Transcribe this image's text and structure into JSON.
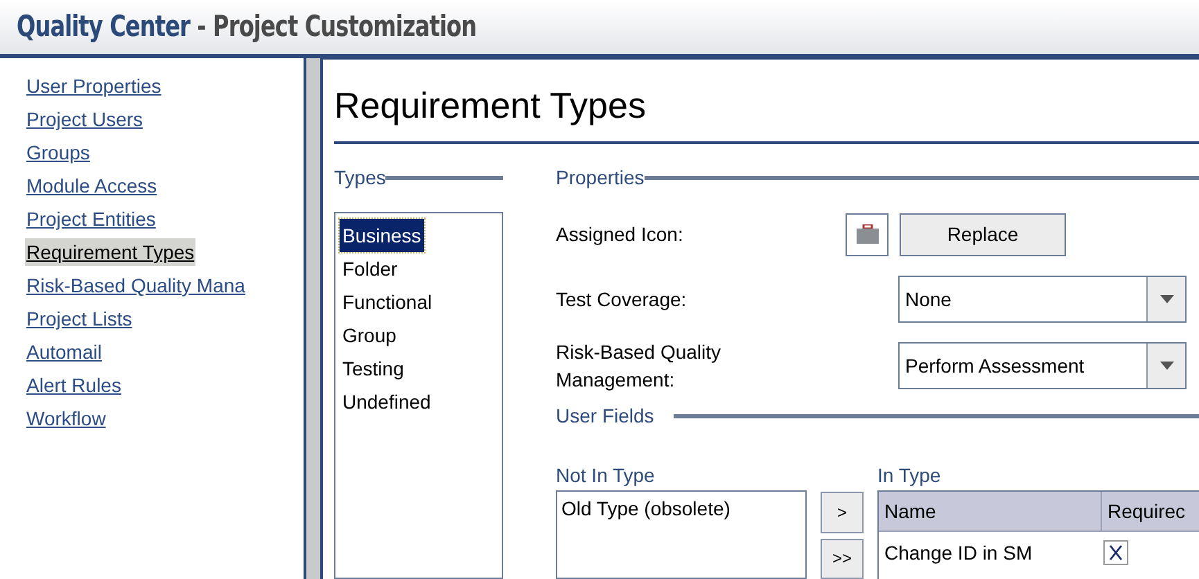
{
  "header": {
    "title_part1": "Quality Center",
    "title_part2": " - Project Customization"
  },
  "sidebar": {
    "items": [
      {
        "label": "User Properties",
        "selected": false
      },
      {
        "label": "Project Users",
        "selected": false
      },
      {
        "label": "Groups",
        "selected": false
      },
      {
        "label": "Module Access",
        "selected": false
      },
      {
        "label": "Project Entities",
        "selected": false
      },
      {
        "label": "Requirement Types",
        "selected": true
      },
      {
        "label": "Risk-Based Quality Mana",
        "selected": false
      },
      {
        "label": "Project Lists",
        "selected": false
      },
      {
        "label": "Automail",
        "selected": false
      },
      {
        "label": "Alert Rules",
        "selected": false
      },
      {
        "label": "Workflow",
        "selected": false
      }
    ]
  },
  "page_title": "Requirement Types",
  "types": {
    "label": "Types",
    "items": [
      {
        "label": "Business",
        "selected": true
      },
      {
        "label": "Folder",
        "selected": false
      },
      {
        "label": "Functional",
        "selected": false
      },
      {
        "label": "Group",
        "selected": false
      },
      {
        "label": "Testing",
        "selected": false
      },
      {
        "label": "Undefined",
        "selected": false
      }
    ]
  },
  "properties": {
    "label": "Properties",
    "assigned_icon_label": "Assigned Icon:",
    "replace_button": "Replace",
    "test_coverage": {
      "label": "Test Coverage:",
      "value": "None"
    },
    "risk_based": {
      "label": "Risk-Based Quality Management:",
      "value": "Perform Assessment"
    }
  },
  "user_fields": {
    "label": "User Fields",
    "not_in_type": {
      "label": "Not In Type",
      "items": [
        "Old Type (obsolete)"
      ]
    },
    "move_buttons": [
      ">",
      ">>"
    ],
    "in_type": {
      "label": "In Type",
      "columns": [
        "Name",
        "Requirec"
      ],
      "rows": [
        {
          "name": "Change ID in SM",
          "required": true
        }
      ]
    }
  }
}
